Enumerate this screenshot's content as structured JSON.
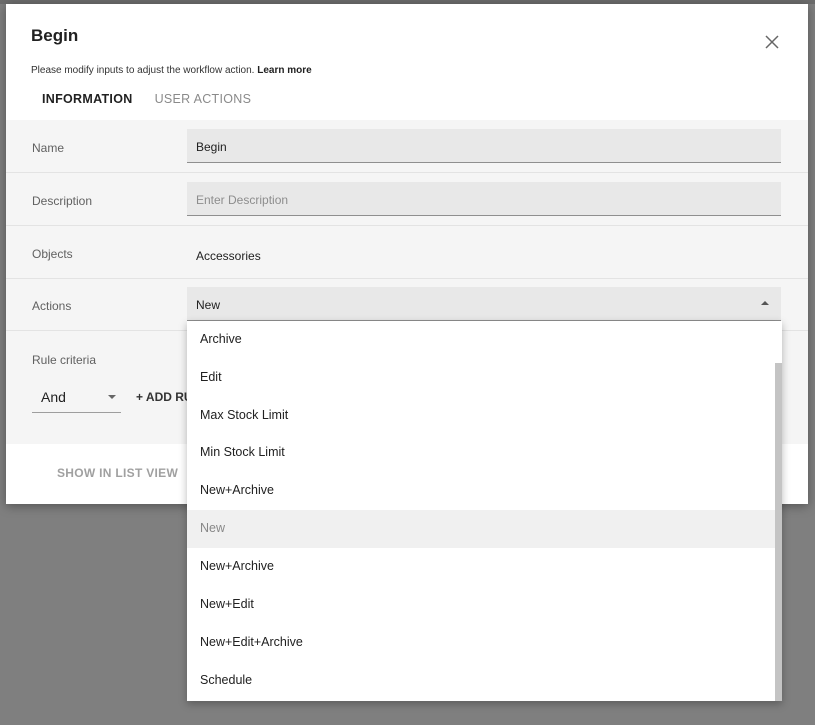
{
  "dialog": {
    "title": "Begin",
    "subtitle": "Please modify inputs to adjust the workflow action.",
    "learn_more": "Learn more",
    "close_icon": "close-icon"
  },
  "tabs": [
    {
      "label": "INFORMATION",
      "active": true
    },
    {
      "label": "USER ACTIONS",
      "active": false
    }
  ],
  "form": {
    "name_label": "Name",
    "name_value": "Begin",
    "description_label": "Description",
    "description_placeholder": "Enter Description",
    "objects_label": "Objects",
    "objects_value": "Accessories",
    "actions_label": "Actions",
    "actions_value": "New",
    "rule_criteria_label": "Rule criteria",
    "rule_operator": "And",
    "add_rule_label": "+ ADD RU"
  },
  "footer": {
    "show_in_list_view": "SHOW IN LIST VIEW"
  },
  "dropdown": {
    "options": [
      "Archive",
      "Edit",
      "Max Stock Limit",
      "Min Stock Limit",
      "New+Archive",
      "New",
      "New+Archive",
      "New+Edit",
      "New+Edit+Archive",
      "Schedule"
    ],
    "selected": "New"
  },
  "colors": {
    "overlay": "#7f7f7f",
    "dialog_bg": "#ffffff",
    "form_bg": "#f5f5f5",
    "field_bg": "#e8e8e8",
    "selected_option_bg": "#f0f0f0"
  }
}
